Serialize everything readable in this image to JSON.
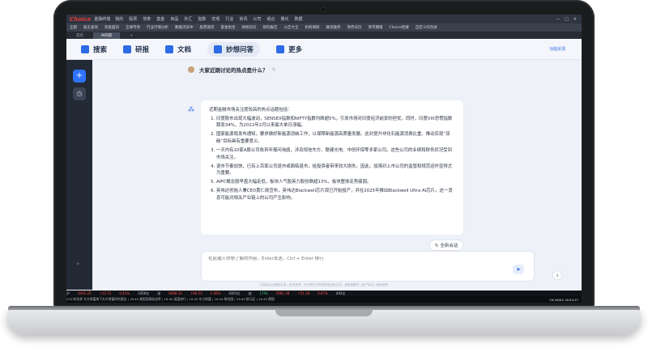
{
  "window": {
    "logo": "Choice",
    "logo_sub": "金融终端",
    "menu": [
      "我的",
      "股票",
      "债券",
      "基金",
      "商品",
      "外汇",
      "指数",
      "宏观",
      "行业",
      "资讯",
      "公司",
      "组合",
      "量化",
      "数据"
    ]
  },
  "toolbar": {
    "items": [
      "全部",
      "股东查询",
      "资金面向",
      "全球市场",
      "行业行情分析",
      "数据浏览中",
      "股票期货",
      "基金组合",
      "财经日历",
      "研究报告",
      "公告大全",
      "机构调研",
      "融资融券",
      "债券日历",
      "债市期限",
      "Choice智搜",
      "自定义综合屏"
    ]
  },
  "tabs": [
    {
      "label": "首页"
    },
    {
      "label": "AI问答"
    }
  ],
  "nav": {
    "items": [
      {
        "label": "搜索",
        "icon": "search-icon"
      },
      {
        "label": "研报",
        "icon": "report-icon"
      },
      {
        "label": "文档",
        "icon": "document-icon"
      },
      {
        "label": "妙想问答",
        "icon": "qa-icon"
      },
      {
        "label": "更多",
        "icon": "more-icon"
      }
    ],
    "feedback": "功能反馈"
  },
  "chat": {
    "question": "大家近期讨论的热点是什么？",
    "intro": "近期金融市场关注度较高的热点话题包括：",
    "items": [
      "印度股市出现大幅波动，SENSEX指数和NIFTY指数均跌超5%，引发市场对印度经济前景的担忧。同时，印度VIX恐慌指数跳涨34%，为2022年2月以来最大单日涨幅。",
      "国家能源局发布通知，要求做好新能源消纳工作，以保障新能源高质量发展。这对提升非化石能源消费比重、推动实现“双碳”目标具有重要意义。",
      "一天内有10家A股公司收到年报问询函，涉及恒信东方、联建光电、中创环保等多家公司。这些公司的业绩和财务状况受到市场关注。",
      "退市节奏加快，已有上百家公司退市或面临退市，给投资者带来较大损失。因此，加强对上市公司的监管和规范运作显得尤为重要。",
      "AIPC概念股早盘大幅走低，板块人气股英力股份跌超13%，板块整体走势疲弱。",
      "英伟达创始人兼CEO黄仁勋宣布，英伟达Blackwell芯片现已开始投产，并在2025年推出Blackwell Ultra AI芯片。这一消息可能对相关产业链上的公司产生影响。"
    ],
    "new_chat": "全新会话",
    "input_placeholder": "在此输入你想了解的内容，Enter发送，Ctrl + Enter 换行",
    "disclaimer": "内容由AI大模型生成，仅供参考，不代表东方财富的观点和立场，请谨慎甄别 | 用户协议 | 隐私政策"
  },
  "ticker": {
    "row1": [
      {
        "text": "沪",
        "cls": ""
      },
      {
        "text": "3091.25",
        "cls": "up"
      },
      {
        "text": "↑12.71",
        "cls": "up"
      },
      {
        "text": "0.41%",
        "cls": "up"
      },
      {
        "text": "3356亿",
        "cls": ""
      },
      {
        "text": "深",
        "cls": ""
      },
      {
        "text": "9468.32",
        "cls": "up"
      },
      {
        "text": "↑86.53",
        "cls": "up"
      },
      {
        "text": "1.06%",
        "cls": "up"
      },
      {
        "text": "4301亿",
        "cls": ""
      },
      {
        "text": "创",
        "cls": ""
      },
      {
        "text": "1794",
        "cls": "down"
      },
      {
        "text": "5981.38",
        "cls": "up"
      },
      {
        "text": "↑51.18",
        "cls": "up"
      },
      {
        "text": "0.87%",
        "cls": "up"
      },
      {
        "text": "442亿",
        "cls": ""
      }
    ],
    "row2": "24小时消息 东方财富旗下东方财富研究报告 | 16:49 美国国债收益率 | 16:49 英国央行 | 16:49 东方财富 | 16:49 联合国 | 16:49 欧元区 | 16:49 德国",
    "time": "CN 06/04 16:54:37"
  }
}
